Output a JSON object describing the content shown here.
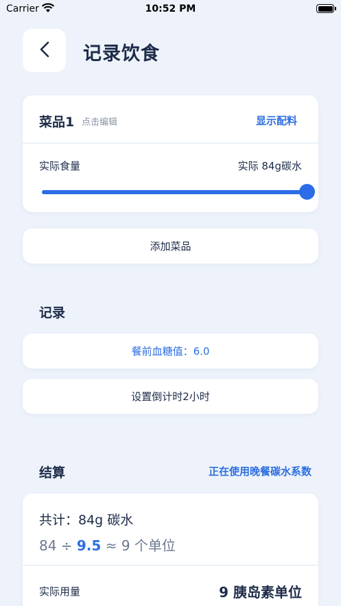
{
  "status_bar": {
    "carrier": "Carrier",
    "time": "10:52 PM",
    "battery_level": 1.0
  },
  "header": {
    "title": "记录饮食"
  },
  "dish": {
    "name": "菜品1",
    "hint": "点击编辑",
    "show_ingredients": "显示配料",
    "qty_label": "实际食量",
    "qty_value": "实际 84g碳水",
    "slider_fraction": 1.0
  },
  "add_dish_label": "添加菜品",
  "record": {
    "title": "记录",
    "glucose_label": "餐前血糖值：6.0",
    "countdown_label": "设置倒计时2小时"
  },
  "settle": {
    "title": "结算",
    "coef_link": "正在使用晚餐碳水系数",
    "total": "共计：84g 碳水",
    "formula_carb": "84 ÷ ",
    "formula_coef": "9.5",
    "formula_result": " ≈ 9 个单位",
    "dose_label": "实际用量",
    "dose_value": "9 胰岛素单位"
  },
  "colors": {
    "accent": "#2e6fe0",
    "background": "#eef3fb"
  }
}
